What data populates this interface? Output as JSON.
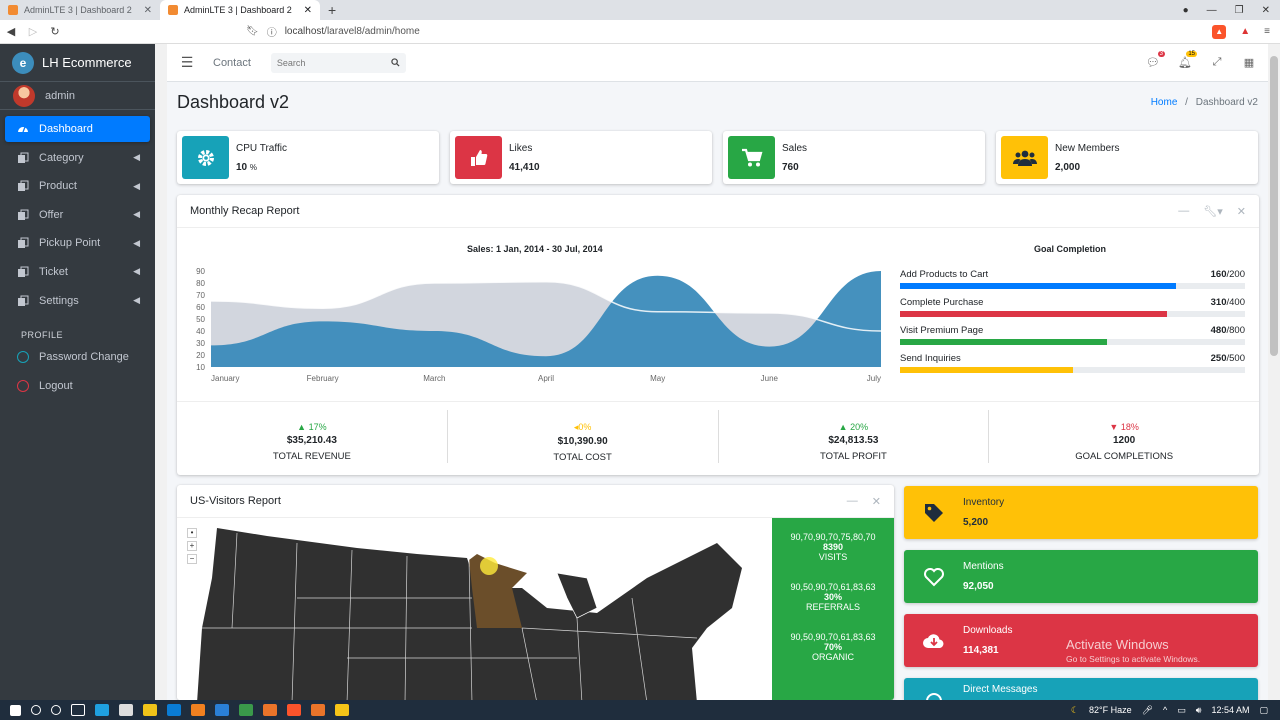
{
  "browser": {
    "tabs": [
      {
        "title": "AdminLTE 3 | Dashboard 2",
        "active": false
      },
      {
        "title": "AdminLTE 3 | Dashboard 2",
        "active": true
      }
    ],
    "url_domain": "localhost",
    "url_path": "/laravel8/admin/home"
  },
  "sidebar": {
    "brand": "LH Ecommerce",
    "brand_logo_letter": "e",
    "user": "admin",
    "items": [
      {
        "label": "Dashboard",
        "active": true
      },
      {
        "label": "Category"
      },
      {
        "label": "Product"
      },
      {
        "label": "Offer"
      },
      {
        "label": "Pickup Point"
      },
      {
        "label": "Ticket"
      },
      {
        "label": "Settings"
      }
    ],
    "section": "PROFILE",
    "profile_items": [
      {
        "label": "Password Change"
      },
      {
        "label": "Logout"
      }
    ]
  },
  "navbar": {
    "contact": "Contact",
    "search_placeholder": "Search",
    "messages_badge": "3",
    "notifications_badge": "15"
  },
  "page": {
    "title": "Dashboard v2",
    "breadcrumb_home": "Home",
    "breadcrumb_sep": "/",
    "breadcrumb_current": "Dashboard v2"
  },
  "info_boxes": [
    {
      "label": "CPU Traffic",
      "value": "10",
      "unit": "%",
      "color": "#17a2b8",
      "icon": "gear-icon"
    },
    {
      "label": "Likes",
      "value": "41,410",
      "color": "#dc3545",
      "icon": "thumbs-up-icon"
    },
    {
      "label": "Sales",
      "value": "760",
      "color": "#28a745",
      "icon": "cart-icon"
    },
    {
      "label": "New Members",
      "value": "2,000",
      "color": "#ffc107",
      "icon": "users-icon"
    }
  ],
  "recap": {
    "title": "Monthly Recap Report",
    "chart_title": "Sales: 1 Jan, 2014 - 30 Jul, 2014",
    "goal_title": "Goal Completion",
    "goals": [
      {
        "label": "Add Products to Cart",
        "value": "160",
        "total": "/200",
        "percent": 80,
        "color": "#007bff"
      },
      {
        "label": "Complete Purchase",
        "value": "310",
        "total": "/400",
        "percent": 77.5,
        "color": "#dc3545"
      },
      {
        "label": "Visit Premium Page",
        "value": "480",
        "total": "/800",
        "percent": 60,
        "color": "#28a745"
      },
      {
        "label": "Send Inquiries",
        "value": "250",
        "total": "/500",
        "percent": 50,
        "color": "#ffc107"
      }
    ],
    "stats": [
      {
        "pct": "17%",
        "dir": "up",
        "color": "#28a745",
        "amount": "$35,210.43",
        "name": "TOTAL REVENUE"
      },
      {
        "pct": "0%",
        "dir": "left",
        "color": "#ffc107",
        "amount": "$10,390.90",
        "name": "TOTAL COST"
      },
      {
        "pct": "20%",
        "dir": "up",
        "color": "#28a745",
        "amount": "$24,813.53",
        "name": "TOTAL PROFIT"
      },
      {
        "pct": "18%",
        "dir": "down",
        "color": "#dc3545",
        "amount": "1200",
        "name": "GOAL COMPLETIONS"
      }
    ]
  },
  "chart_data": {
    "type": "area",
    "title": "Sales: 1 Jan, 2014 - 30 Jul, 2014",
    "categories": [
      "January",
      "February",
      "March",
      "April",
      "May",
      "June",
      "July"
    ],
    "ylim": [
      10,
      90
    ],
    "yticks": [
      10,
      20,
      30,
      40,
      50,
      60,
      70,
      80,
      90
    ],
    "series": [
      {
        "values": [
          65,
          59,
          80,
          81,
          56,
          55,
          40
        ],
        "color": "#d2d6de"
      },
      {
        "values": [
          28,
          48,
          40,
          19,
          86,
          27,
          90
        ],
        "color": "#3b8bba"
      }
    ]
  },
  "visitors": {
    "title": "US-Visitors Report",
    "zoom_reset": "•",
    "zoom_in": "+",
    "zoom_out": "−",
    "stats": [
      {
        "spark": "90,70,90,70,75,80,70",
        "value": "8390",
        "label": "VISITS"
      },
      {
        "spark": "90,50,90,70,61,83,63",
        "value": "30%",
        "label": "REFERRALS"
      },
      {
        "spark": "90,50,90,70,61,83,63",
        "value": "70%",
        "label": "ORGANIC"
      }
    ]
  },
  "small_boxes": [
    {
      "label": "Inventory",
      "value": "5,200",
      "color": "#ffc107",
      "text": "#1f2d3d",
      "icon": "tag-icon"
    },
    {
      "label": "Mentions",
      "value": "92,050",
      "color": "#28a745",
      "text": "#ffffff",
      "icon": "heart-icon"
    },
    {
      "label": "Downloads",
      "value": "114,381",
      "color": "#dc3545",
      "text": "#ffffff",
      "icon": "cloud-download-icon"
    },
    {
      "label": "Direct Messages",
      "value": "",
      "color": "#17a2b8",
      "text": "#ffffff",
      "icon": "comments-icon"
    }
  ],
  "watermark": {
    "line1": "Activate Windows",
    "line2": "Go to Settings to activate Windows."
  },
  "taskbar": {
    "weather": "82°F  Haze",
    "time": "12:54 AM"
  }
}
